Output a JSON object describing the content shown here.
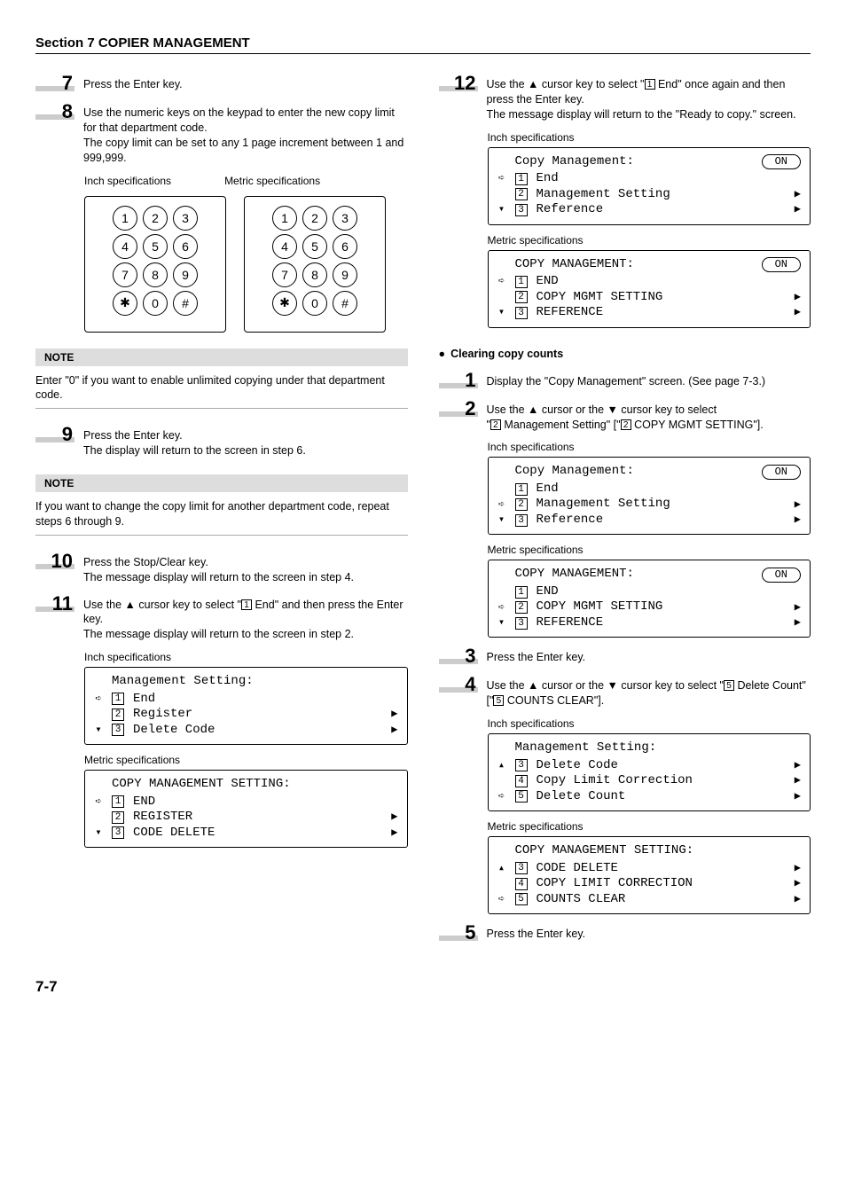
{
  "section_title": "Section 7  COPIER MANAGEMENT",
  "page_number": "7-7",
  "keypad_labels": {
    "inch": "Inch specifications",
    "metric": "Metric specifications"
  },
  "left": {
    "steps": {
      "7": "Press the Enter key.",
      "8": "Use the numeric keys on the keypad to enter the new copy limit for that department code.",
      "8b": "The copy limit can be set to any 1 page increment between 1 and 999,999.",
      "9": "Press the Enter key.",
      "9b": "The display will return to the screen in step 6.",
      "10": "Press the Stop/Clear key.",
      "10b": "The message display will return to the screen in step 4.",
      "11a": "Use the ▲ cursor key to select \"",
      "11b": " End\" and then press the Enter key.",
      "11c": "The message display will return to the screen in step 2."
    },
    "note1": {
      "label": "NOTE",
      "text": "Enter \"0\" if you want to enable unlimited copying under that department code."
    },
    "note2": {
      "label": "NOTE",
      "text": "If you want to change the copy limit for another department code, repeat steps 6 through 9."
    },
    "spec_inch": "Inch specifications",
    "spec_metric": "Metric specifications",
    "disp11_inch": {
      "title": "Management Setting:",
      "i1": "End",
      "i2": "Register",
      "i3": "Delete Code"
    },
    "disp11_metric": {
      "title": "COPY MANAGEMENT SETTING:",
      "i1": "END",
      "i2": "REGISTER",
      "i3": "CODE DELETE"
    }
  },
  "right": {
    "steps": {
      "12a": "Use the ▲ cursor key to select \"",
      "12b": " End\" once again and then press the Enter key.",
      "12c": "The message display will return to the \"Ready to copy.\" screen.",
      "c1": "Display the \"Copy Management\" screen. (See page 7-3.)",
      "c2a": "Use the ▲ cursor or the ▼ cursor key to select",
      "c2b": "\"",
      "c2c": " Management Setting\" [\"",
      "c2d": " COPY MGMT SETTING\"].",
      "c3": "Press the Enter key.",
      "c4a": "Use the ▲ cursor or the ▼ cursor key to select \"",
      "c4b": " Delete Count\" [\"",
      "c4c": " COUNTS CLEAR\"].",
      "c5": "Press the Enter key."
    },
    "subhead": "Clearing copy counts",
    "spec_inch": "Inch specifications",
    "spec_metric": "Metric specifications",
    "disp12_inch": {
      "title": "Copy Management:",
      "on": "ON",
      "i1": "End",
      "i2": "Management Setting",
      "i3": "Reference"
    },
    "disp12_metric": {
      "title": "COPY MANAGEMENT:",
      "on": "ON",
      "i1": "END",
      "i2": "COPY MGMT SETTING",
      "i3": "REFERENCE"
    },
    "disp2_inch": {
      "title": "Copy Management:",
      "on": "ON",
      "i1": "End",
      "i2": "Management Setting",
      "i3": "Reference"
    },
    "disp2_metric": {
      "title": "COPY MANAGEMENT:",
      "on": "ON",
      "i1": "END",
      "i2": "COPY MGMT SETTING",
      "i3": "REFERENCE"
    },
    "disp4_inch": {
      "title": "Management Setting:",
      "i3": "Delete Code",
      "i4": "Copy Limit Correction",
      "i5": "Delete Count"
    },
    "disp4_metric": {
      "title": "COPY MANAGEMENT SETTING:",
      "i3": "CODE DELETE",
      "i4": "COPY LIMIT CORRECTION",
      "i5": "COUNTS CLEAR"
    }
  }
}
